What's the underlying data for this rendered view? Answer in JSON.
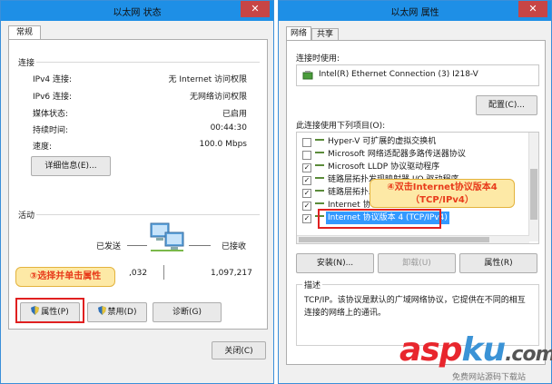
{
  "left_window": {
    "title": "以太网 状态",
    "close_glyph": "✕",
    "tab": "常规",
    "connection_group": "连接",
    "rows": [
      {
        "label": "IPv4 连接:",
        "value": "无 Internet 访问权限"
      },
      {
        "label": "IPv6 连接:",
        "value": "无网络访问权限"
      },
      {
        "label": "媒体状态:",
        "value": "已启用"
      },
      {
        "label": "持续时间:",
        "value": "00:44:30"
      },
      {
        "label": "速度:",
        "value": "100.0 Mbps"
      }
    ],
    "details_button": "详细信息(E)...",
    "activity_group": "活动",
    "sent_label": "已发送",
    "received_label": "已接收",
    "bytes_sent": ",032",
    "bytes_received": "1,097,217",
    "properties_button": "属性(P)",
    "disable_button": "禁用(D)",
    "diagnose_button": "诊断(G)",
    "close_button": "关闭(C)",
    "callout": "③选择并单击属性"
  },
  "right_window": {
    "title": "以太网 属性",
    "close_glyph": "✕",
    "tabs": [
      "网络",
      "共享"
    ],
    "connect_using_label": "连接时使用:",
    "adapter_name": "Intel(R) Ethernet Connection (3) I218-V",
    "configure_button": "配置(C)...",
    "items_label": "此连接使用下列项目(O):",
    "items": [
      {
        "label": "Hyper-V 可扩展的虚拟交换机",
        "checked": false
      },
      {
        "label": "Microsoft 网络适配器多路传送器协议",
        "checked": false
      },
      {
        "label": "Microsoft LLDP 协议驱动程序",
        "checked": true
      },
      {
        "label": "链路层拓扑发现映射器 I/O 驱动程序",
        "checked": true
      },
      {
        "label": "链路层拓扑发现响应程序",
        "checked": true
      },
      {
        "label": "Internet 协议版本 6 (TCP/IPv6)",
        "checked": true
      },
      {
        "label": "Internet 协议版本 4 (TCP/IPv4)",
        "checked": true,
        "selected": true
      }
    ],
    "install_button": "安装(N)...",
    "uninstall_button": "卸载(U)",
    "properties_button": "属性(R)",
    "description_label": "描述",
    "description_text": "TCP/IP。该协议是默认的广域网络协议，它提供在不同的相互连接的网络上的通讯。",
    "callout_line1": "④双击Internet协议版本4",
    "callout_line2": "（TCP/IPv4）"
  },
  "watermark": {
    "brand_a": "asp",
    "brand_b": "ku",
    "brand_c": ".com",
    "tagline": "免费网站源码下载站"
  },
  "colors": {
    "titlebar": "#1e8fe6",
    "close_button": "#c74545",
    "selection": "#3399ff",
    "callout_bg": "#fde9a6",
    "callout_text": "#e83b1b",
    "highlight_box": "#e02020"
  }
}
